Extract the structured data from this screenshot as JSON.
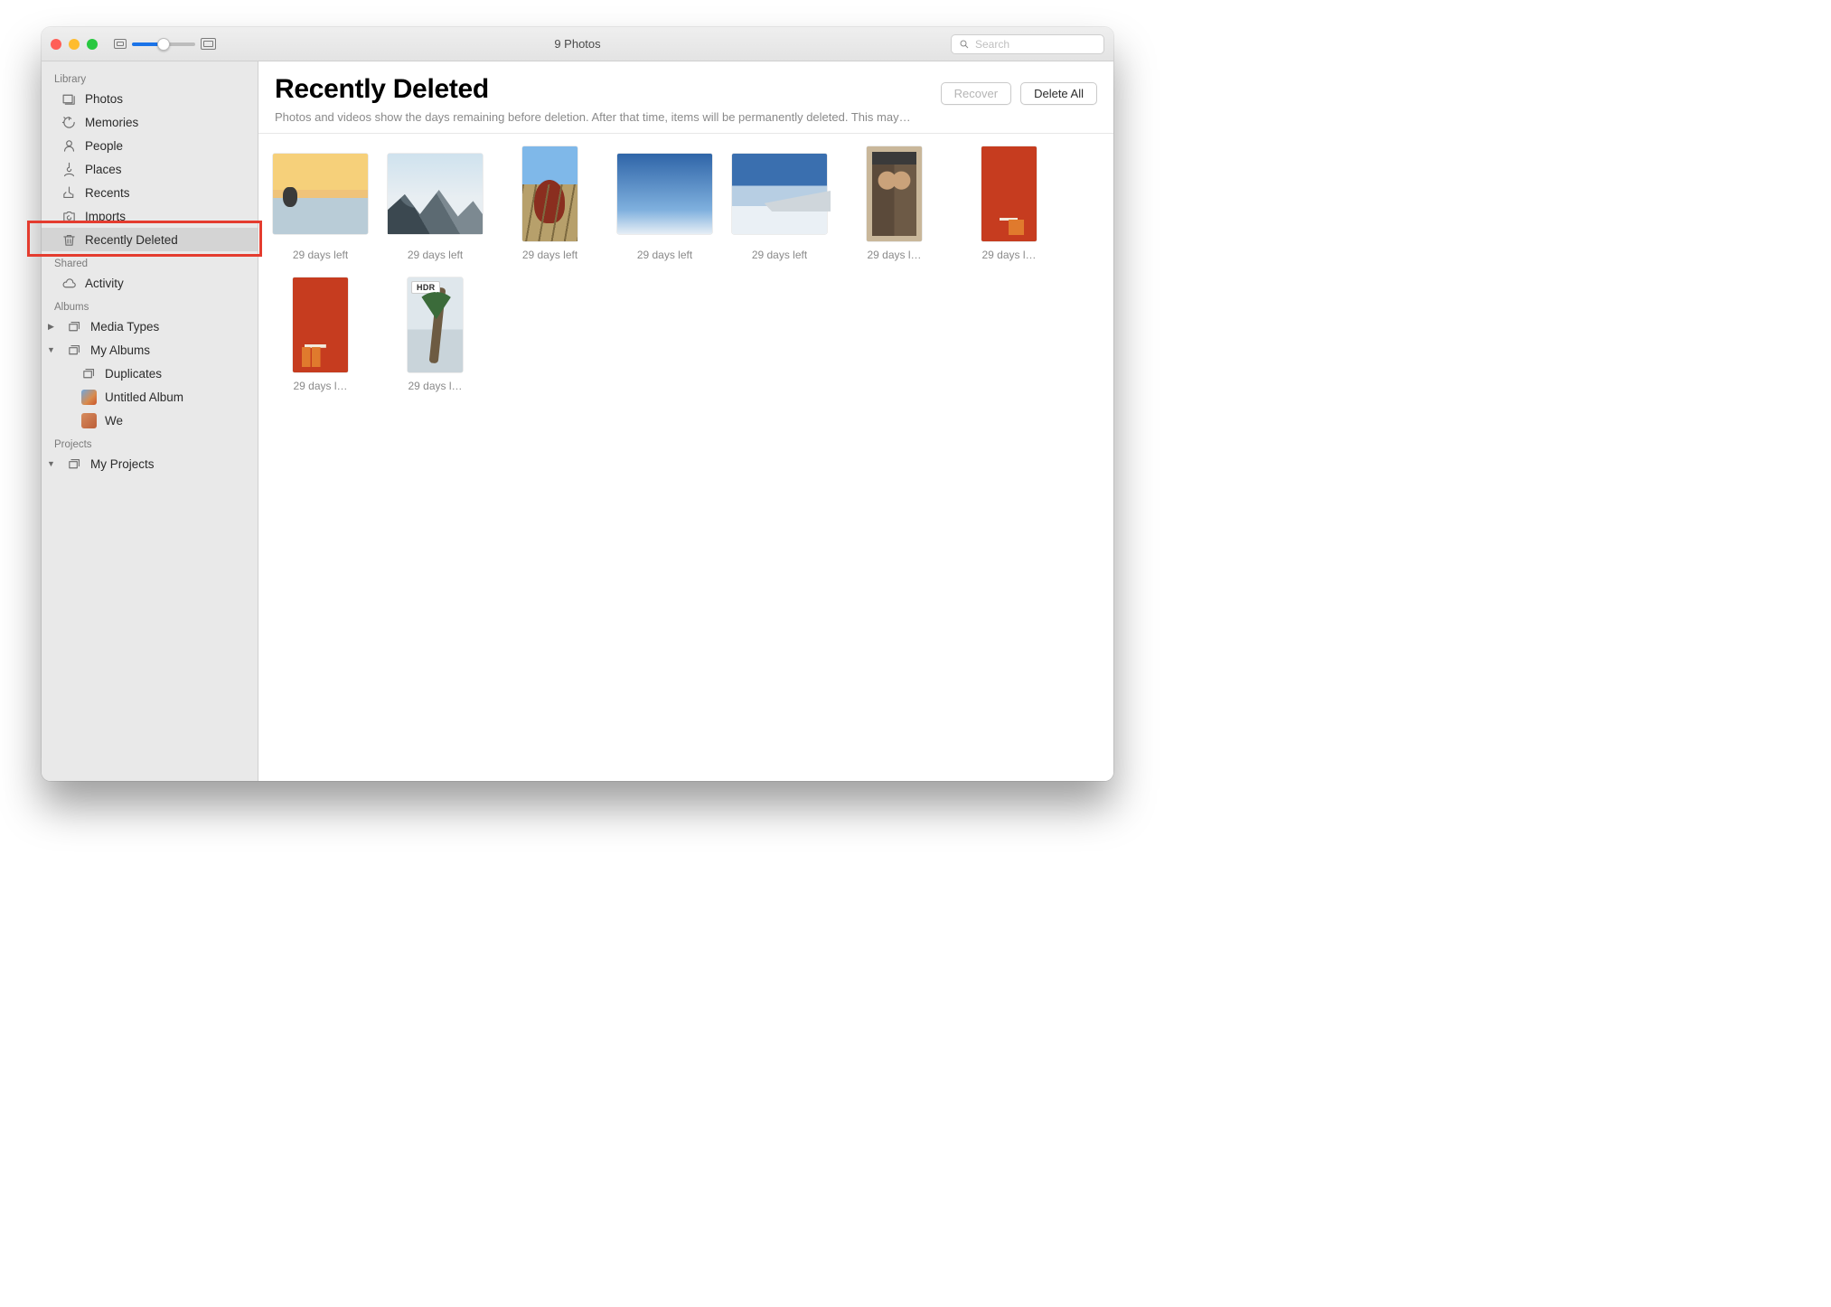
{
  "window_title": "9 Photos",
  "search": {
    "placeholder": "Search"
  },
  "header": {
    "title": "Recently Deleted",
    "recover_label": "Recover",
    "delete_all_label": "Delete All",
    "subtext": "Photos and videos show the days remaining before deletion. After that time, items will be permanently deleted. This may…"
  },
  "sidebar": {
    "library_label": "Library",
    "library": [
      {
        "label": "Photos",
        "icon": "photos-icon"
      },
      {
        "label": "Memories",
        "icon": "memories-icon"
      },
      {
        "label": "People",
        "icon": "people-icon"
      },
      {
        "label": "Places",
        "icon": "places-icon"
      },
      {
        "label": "Recents",
        "icon": "recents-icon"
      },
      {
        "label": "Imports",
        "icon": "imports-icon"
      },
      {
        "label": "Recently Deleted",
        "icon": "trash-icon",
        "selected": true
      }
    ],
    "shared_label": "Shared",
    "shared": [
      {
        "label": "Activity",
        "icon": "cloud-icon"
      }
    ],
    "albums_label": "Albums",
    "albums": [
      {
        "label": "Media Types",
        "icon": "stack-icon",
        "disclosure": "right"
      },
      {
        "label": "My Albums",
        "icon": "stack-icon",
        "disclosure": "down",
        "children": [
          {
            "label": "Duplicates",
            "icon": "stack-icon"
          },
          {
            "label": "Untitled Album",
            "icon": "thumb"
          },
          {
            "label": "We",
            "icon": "thumb-alt"
          }
        ]
      }
    ],
    "projects_label": "Projects",
    "projects": [
      {
        "label": "My Projects",
        "icon": "stack-icon",
        "disclosure": "down"
      }
    ]
  },
  "photos": [
    {
      "caption": "29 days left",
      "orient": "landscape",
      "art": "art-sunset"
    },
    {
      "caption": "29 days left",
      "orient": "landscape",
      "art": "art-mtn"
    },
    {
      "caption": "29 days left",
      "orient": "portrait",
      "art": "art-vineyard"
    },
    {
      "caption": "29 days left",
      "orient": "landscape",
      "art": "art-sky"
    },
    {
      "caption": "29 days left",
      "orient": "landscape",
      "art": "art-wing"
    },
    {
      "caption": "29 days l…",
      "orient": "portrait",
      "art": "art-mural"
    },
    {
      "caption": "29 days l…",
      "orient": "portrait",
      "art": "art-cafe"
    },
    {
      "caption": "29 days l…",
      "orient": "portrait",
      "art": "art-cafe2"
    },
    {
      "caption": "29 days l…",
      "orient": "portrait",
      "art": "art-palm",
      "badge": "HDR"
    }
  ]
}
